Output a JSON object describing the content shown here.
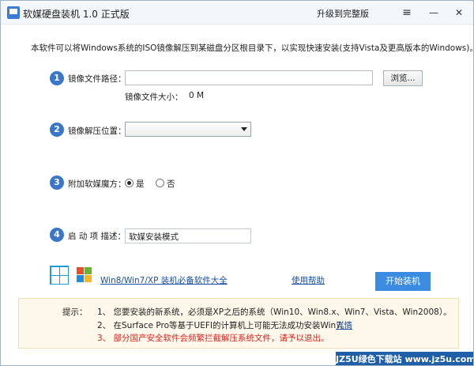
{
  "titlebar": {
    "title": "软媒硬盘装机 1.0 正式版",
    "upgrade": "升级到完整版",
    "menu_glyph": "≡",
    "minimize_glyph": "—",
    "close_glyph": "✕"
  },
  "description": "本软件可以将Windows系统的ISO镜像解压到某磁盘分区根目录下，以实现快速安装(支持Vista及更高版本的Windows)。",
  "steps": {
    "s1": {
      "num": "1",
      "label": "镜像文件路径：",
      "browse": "浏览...",
      "size_label": "镜像文件大小：",
      "size_value": "0 M",
      "path_value": ""
    },
    "s2": {
      "num": "2",
      "label": "镜像解压位置：",
      "selected": ""
    },
    "s3": {
      "num": "3",
      "label": "附加软媒魔方：",
      "yes": "是",
      "no": "否",
      "selected": "是"
    },
    "s4": {
      "num": "4",
      "label": "启 动 项 描述：",
      "value": "软媒安装模式"
    }
  },
  "footer": {
    "software_link": "Win8/Win7/XP 装机必备软件大全",
    "help_link": "使用帮助",
    "start_button": "开始装机"
  },
  "tips": {
    "heading": "提示：",
    "items": [
      "1、 您要安装的新系统，必须是XP之后的系统（Win10、Win8.x、Win7、Vista、Win2008）。",
      "2、 在Surface Pro等基于UEFI的计算机上可能无法成功安装Win7。",
      "3、 部分国产安全软件会频繁拦截解压系统文件，请予以退出。"
    ],
    "details_link": "详情"
  },
  "colors": {
    "accent": "#3a77c9",
    "button": "#3b8be0",
    "warning": "#e02020",
    "link": "#1a4fa0",
    "tips_bg": "#fdf8e9"
  },
  "watermark": "JZ5U绿色下载站 www.jz5u.com"
}
